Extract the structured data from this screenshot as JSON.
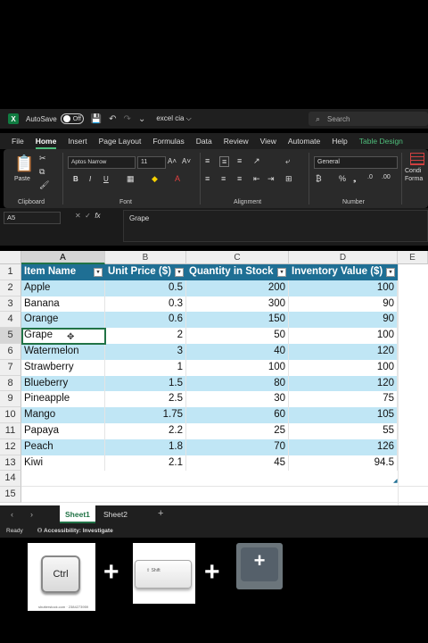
{
  "titlebar": {
    "app_icon": "X",
    "autosave_label": "AutoSave",
    "autosave_state": "Off",
    "filename": "excel cia ⌵",
    "search_placeholder": "Search"
  },
  "menu": {
    "tabs": [
      "File",
      "Home",
      "Insert",
      "Page Layout",
      "Formulas",
      "Data",
      "Review",
      "View",
      "Automate",
      "Help",
      "Table Design"
    ]
  },
  "ribbon": {
    "paste_label": "Paste",
    "clipboard_label": "Clipboard",
    "font_name": "Aptos Narrow",
    "font_size": "11",
    "font_label": "Font",
    "alignment_label": "Alignment",
    "number_format": "General",
    "number_label": "Number",
    "cond_format_label": "Condi Forma"
  },
  "formula_bar": {
    "name_box": "A5",
    "content": "Grape"
  },
  "sheet": {
    "columns": [
      "A",
      "B",
      "C",
      "D",
      "E"
    ],
    "row_numbers": [
      "1",
      "2",
      "3",
      "4",
      "5",
      "6",
      "7",
      "8",
      "9",
      "10",
      "11",
      "12",
      "13",
      "14",
      "15"
    ],
    "headers": [
      "Item Name",
      "Unit Price ($)",
      "Quantity in Stock",
      "Inventory Value ($)"
    ],
    "rows": [
      [
        "Apple",
        "0.5",
        "200",
        "100"
      ],
      [
        "Banana",
        "0.3",
        "300",
        "90"
      ],
      [
        "Orange",
        "0.6",
        "150",
        "90"
      ],
      [
        "Grape",
        "2",
        "50",
        "100"
      ],
      [
        "Watermelon",
        "3",
        "40",
        "120"
      ],
      [
        "Strawberry",
        "1",
        "100",
        "100"
      ],
      [
        "Blueberry",
        "1.5",
        "80",
        "120"
      ],
      [
        "Pineapple",
        "2.5",
        "30",
        "75"
      ],
      [
        "Mango",
        "1.75",
        "60",
        "105"
      ],
      [
        "Papaya",
        "2.2",
        "25",
        "55"
      ],
      [
        "Peach",
        "1.8",
        "70",
        "126"
      ],
      [
        "Kiwi",
        "2.1",
        "45",
        "94.5"
      ]
    ],
    "active_cell": "A5"
  },
  "sheet_tabs": [
    "Sheet1",
    "Sheet2"
  ],
  "status": {
    "ready": "Ready",
    "accessibility": "Accessibility: Investigate"
  },
  "shortcut": {
    "key1": "Ctrl",
    "key2": "⇧ Shift",
    "key3": "+",
    "plus": "+",
    "watermark": "shutterstock.com · 2384273959"
  },
  "colors": {
    "excel_green": "#217346",
    "table_header": "#1f6f94",
    "band": "#c0e6f5"
  }
}
